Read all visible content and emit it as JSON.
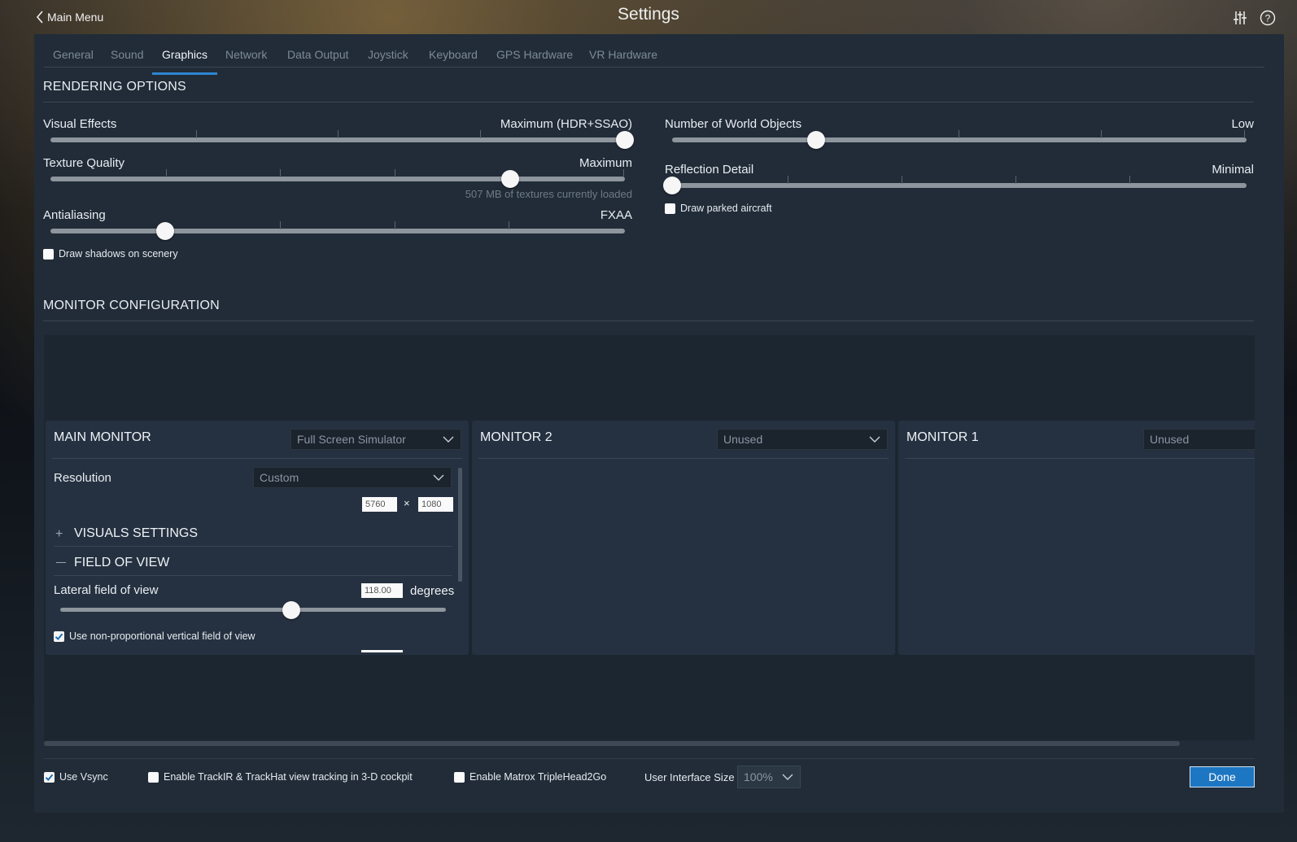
{
  "topbar": {
    "back_label": "Main Menu",
    "title": "Settings",
    "icons": [
      "sliders-icon",
      "help-icon"
    ]
  },
  "tabs": [
    {
      "label": "General",
      "active": false
    },
    {
      "label": "Sound",
      "active": false
    },
    {
      "label": "Graphics",
      "active": true
    },
    {
      "label": "Network",
      "active": false
    },
    {
      "label": "Data Output",
      "active": false
    },
    {
      "label": "Joystick",
      "active": false
    },
    {
      "label": "Keyboard",
      "active": false
    },
    {
      "label": "GPS Hardware",
      "active": false
    },
    {
      "label": "VR Hardware",
      "active": false
    }
  ],
  "rendering": {
    "title": "RENDERING OPTIONS",
    "visual_effects": {
      "label": "Visual Effects",
      "value": "Maximum (HDR+SSAO)",
      "level": 1.0
    },
    "texture_quality": {
      "label": "Texture Quality",
      "value": "Maximum",
      "level": 0.8,
      "note": "507 MB of textures currently loaded"
    },
    "antialiasing": {
      "label": "Antialiasing",
      "value": "FXAA",
      "level": 0.2
    },
    "shadows": {
      "label": "Draw shadows on scenery",
      "checked": false
    },
    "world_objects": {
      "label": "Number of World Objects",
      "value": "Low",
      "level": 0.25
    },
    "reflection_detail": {
      "label": "Reflection Detail",
      "value": "Minimal",
      "level": 0.0
    },
    "parked_aircraft": {
      "label": "Draw parked aircraft",
      "checked": false
    }
  },
  "monitor_config": {
    "title": "MONITOR CONFIGURATION",
    "main": {
      "title": "MAIN MONITOR",
      "mode": "Full Screen Simulator",
      "resolution_label": "Resolution",
      "resolution_mode": "Custom",
      "width": "5760",
      "times": "×",
      "height": "1080",
      "visuals_settings": "VISUALS SETTINGS",
      "field_of_view": "FIELD OF VIEW",
      "lateral_fov_label": "Lateral field of view",
      "lateral_fov_value": "118.00",
      "lateral_fov_unit": "degrees",
      "lateral_fov_level": 0.6,
      "nonprop_label": "Use non-proportional vertical field of view",
      "nonprop_checked": true
    },
    "monitor2": {
      "title": "MONITOR 2",
      "mode": "Unused"
    },
    "monitor1": {
      "title": "MONITOR 1",
      "mode": "Unused"
    }
  },
  "bottom": {
    "vsync": {
      "label": "Use Vsync",
      "checked": true
    },
    "trackir": {
      "label": "Enable TrackIR & TrackHat view tracking in 3-D cockpit",
      "checked": false
    },
    "matrox": {
      "label": "Enable Matrox TripleHead2Go",
      "checked": false
    },
    "ui_size_label": "User Interface Size",
    "ui_size_value": "100%",
    "done_label": "Done"
  }
}
